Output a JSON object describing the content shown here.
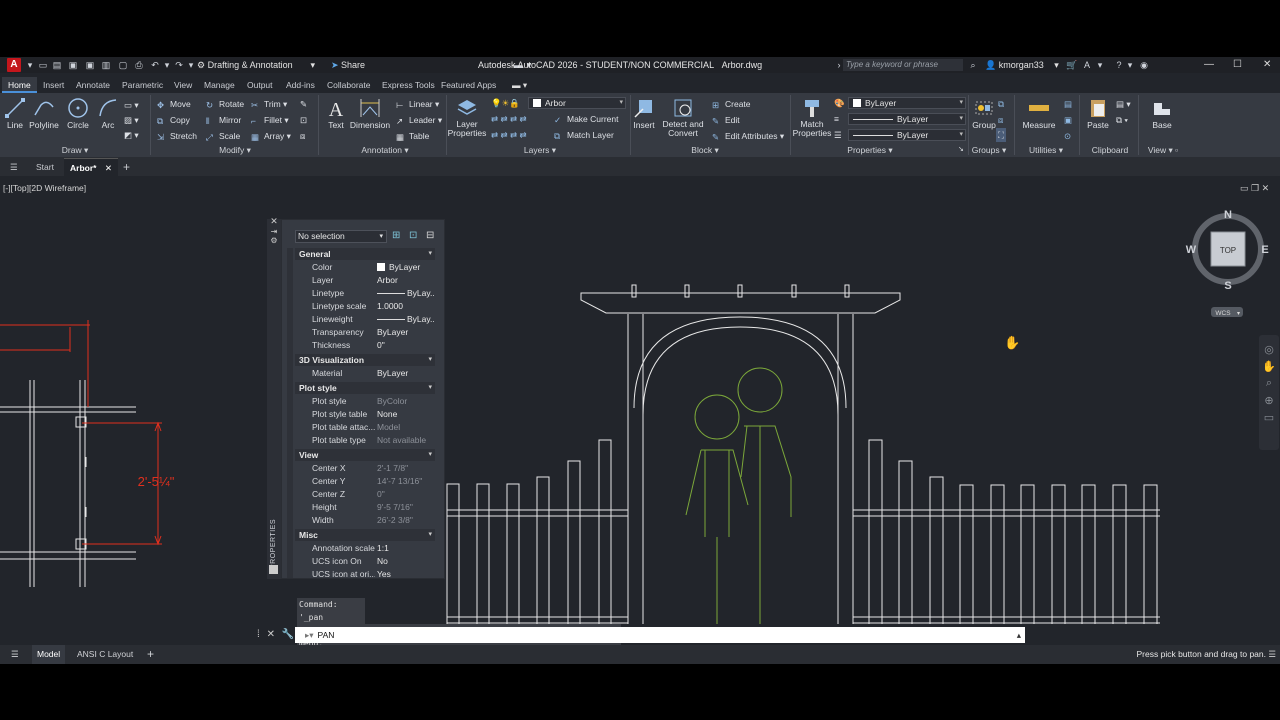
{
  "titlebar": {
    "logo": "A",
    "workspace": "Drafting & Annotation",
    "share": "Share",
    "title": "Autodesk AutoCAD 2026 - STUDENT/NON COMMERCIAL",
    "filename": "Arbor.dwg",
    "search_placeholder": "Type a keyword or phrase",
    "user": "kmorgan33"
  },
  "ribbon_tabs": [
    "Home",
    "Insert",
    "Annotate",
    "Parametric",
    "View",
    "Manage",
    "Output",
    "Add-ins",
    "Collaborate",
    "Express Tools",
    "Featured Apps"
  ],
  "ribbon": {
    "draw": {
      "label": "Draw",
      "line": "Line",
      "polyline": "Polyline",
      "circle": "Circle",
      "arc": "Arc"
    },
    "modify": {
      "label": "Modify",
      "move": "Move",
      "rotate": "Rotate",
      "trim": "Trim",
      "copy": "Copy",
      "mirror": "Mirror",
      "fillet": "Fillet",
      "stretch": "Stretch",
      "scale": "Scale",
      "array": "Array"
    },
    "annotation": {
      "label": "Annotation",
      "text": "Text",
      "dimension": "Dimension",
      "linear": "Linear",
      "leader": "Leader",
      "table": "Table"
    },
    "layers": {
      "label": "Layers",
      "layer_properties": "Layer Properties",
      "current_layer": "Arbor",
      "make_current": "Make Current",
      "match_layer": "Match Layer"
    },
    "block": {
      "label": "Block",
      "insert": "Insert",
      "detect": "Detect and Convert",
      "create": "Create",
      "edit": "Edit",
      "edit_attributes": "Edit Attributes"
    },
    "properties": {
      "label": "Properties",
      "match": "Match Properties",
      "color": "ByLayer",
      "linetype": "ByLayer",
      "lineweight": "ByLayer"
    },
    "groups": {
      "label": "Groups",
      "group": "Group"
    },
    "utilities": {
      "label": "Utilities",
      "measure": "Measure"
    },
    "clipboard": {
      "label": "Clipboard",
      "paste": "Paste"
    },
    "view": {
      "label": "View",
      "base": "Base"
    }
  },
  "doc_tabs": {
    "start": "Start",
    "active": "Arbor*"
  },
  "viewport_label": "[-][Top][2D Wireframe]",
  "properties_palette": {
    "side_label": "PROPERTIES",
    "selection": "No selection",
    "sections": [
      {
        "title": "General",
        "rows": [
          [
            "Color",
            "ByLayer"
          ],
          [
            "Layer",
            "Arbor"
          ],
          [
            "Linetype",
            "ByLay..."
          ],
          [
            "Linetype scale",
            "1.0000"
          ],
          [
            "Lineweight",
            "ByLay..."
          ],
          [
            "Transparency",
            "ByLayer"
          ],
          [
            "Thickness",
            "0\""
          ]
        ]
      },
      {
        "title": "3D Visualization",
        "rows": [
          [
            "Material",
            "ByLayer"
          ]
        ]
      },
      {
        "title": "Plot style",
        "rows": [
          [
            "Plot style",
            "ByColor"
          ],
          [
            "Plot style table",
            "None"
          ],
          [
            "Plot table attac...",
            "Model"
          ],
          [
            "Plot table type",
            "Not available"
          ]
        ]
      },
      {
        "title": "View",
        "rows": [
          [
            "Center X",
            "2'-1 7/8\""
          ],
          [
            "Center Y",
            "14'-7 13/16\""
          ],
          [
            "Center Z",
            "0\""
          ],
          [
            "Height",
            "9'-5 7/16\""
          ],
          [
            "Width",
            "26'-2 3/8\""
          ]
        ]
      },
      {
        "title": "Misc",
        "rows": [
          [
            "Annotation scale",
            "1:1"
          ],
          [
            "UCS icon On",
            "No"
          ],
          [
            "UCS icon at ori...",
            "Yes"
          ]
        ]
      }
    ]
  },
  "dimension_text": "2'-5¼\"",
  "viewcube": {
    "n": "N",
    "s": "S",
    "e": "E",
    "w": "W",
    "face": "TOP",
    "wcs": "WCS"
  },
  "command": {
    "history": [
      "Command: '_pan",
      "Press ESC or ENTER to exit, or right-click to display shortcut menu."
    ],
    "current": "PAN"
  },
  "status": {
    "model": "Model",
    "layout": "ANSI C Layout",
    "message": "Press pick button and drag to pan."
  },
  "colors": {
    "accent": "#4a90d9",
    "red": "#e0301e",
    "green": "#7ca83a",
    "logo": "#c4161c"
  }
}
